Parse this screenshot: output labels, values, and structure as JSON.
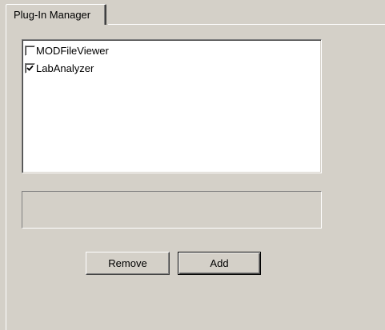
{
  "tabs": [
    {
      "label": "Plug-In Manager",
      "active": true
    }
  ],
  "plugins": [
    {
      "name": "MODFileViewer",
      "checked": false
    },
    {
      "name": "LabAnalyzer",
      "checked": true
    }
  ],
  "status_text": "",
  "buttons": {
    "remove_label": "Remove",
    "add_label": "Add"
  },
  "colors": {
    "face": "#d4d0c8",
    "window": "#ffffff"
  }
}
